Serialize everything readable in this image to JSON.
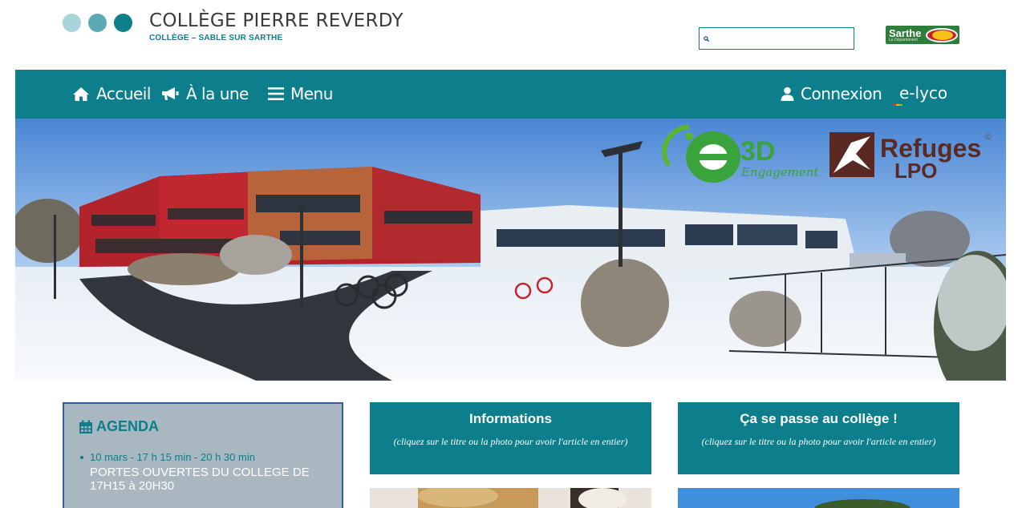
{
  "header": {
    "title": "COLLÈGE PIERRE REVERDY",
    "subtitle": "COLLÈGE – SABLE SUR SARTHE",
    "dot_colors": [
      "#a9d4da",
      "#5aa9b3",
      "#0d7f8c"
    ],
    "search": {
      "placeholder": "",
      "value": "",
      "icon": "search-icon"
    },
    "partner_logo": {
      "word": "Sarthe",
      "small": "Le Département"
    }
  },
  "nav": {
    "items": [
      {
        "label": "Accueil",
        "icon": "home-icon"
      },
      {
        "label": "À la une",
        "icon": "megaphone-icon"
      },
      {
        "label": "Menu",
        "icon": "hamburger-icon"
      }
    ],
    "login": {
      "label": "Connexion",
      "icon": "user-icon"
    },
    "elyco": "e-lyco"
  },
  "banner": {
    "e3d_top": "3D",
    "e3d_bottom": "Engagement",
    "refuges_top": "Refuges",
    "refuges_bottom": "LPO",
    "copyright": "©"
  },
  "agenda": {
    "title": "AGENDA",
    "icon": "calendar-icon",
    "items": [
      {
        "date": "10 mars - 17 h 15 min - 20 h 30 min",
        "desc": "PORTES OUVERTES DU COLLEGE DE 17H15 à 20H30"
      }
    ]
  },
  "panels": [
    {
      "title": "Informations",
      "note": "(cliquez sur le titre ou la photo pour avoir l'article en entier)"
    },
    {
      "title": "Ça se passe au collège !",
      "note": "(cliquez sur le titre ou la photo pour avoir l'article en entier)"
    }
  ],
  "colors": {
    "brand": "#0d7f8c",
    "agenda_bg": "#a9b7c1",
    "agenda_border": "#2c5fa0"
  }
}
